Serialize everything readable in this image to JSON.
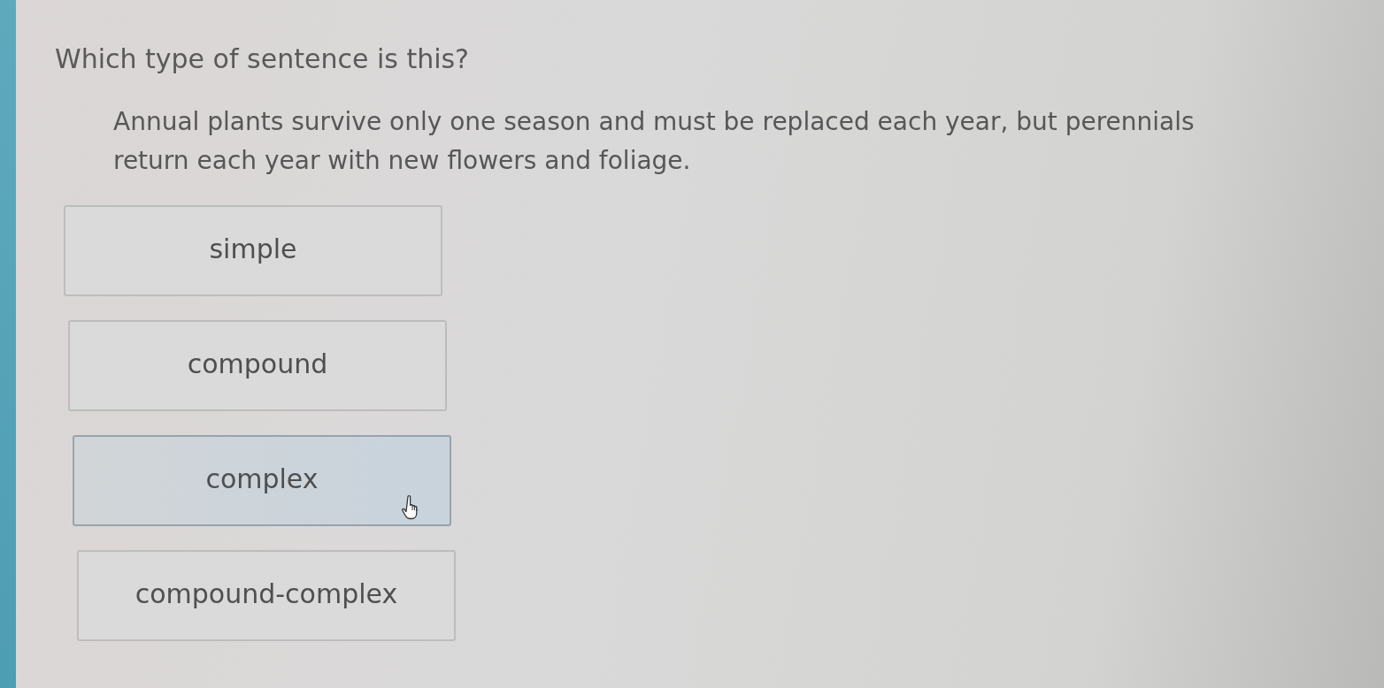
{
  "question": "Which type of sentence is this?",
  "passage": "Annual plants survive only one season and must be replaced each year, but perennials return each year with new flowers and foliage.",
  "options": [
    {
      "label": "simple",
      "hovered": false
    },
    {
      "label": "compound",
      "hovered": false
    },
    {
      "label": "complex",
      "hovered": true
    },
    {
      "label": "compound-complex",
      "hovered": false
    }
  ]
}
